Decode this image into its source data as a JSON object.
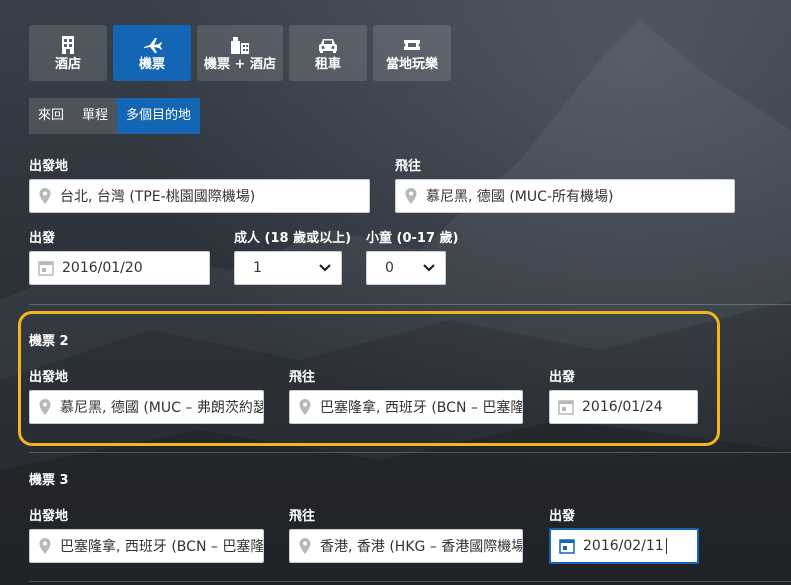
{
  "tabs": [
    {
      "label": "酒店",
      "icon": "hotel-icon"
    },
    {
      "label": "機票",
      "icon": "plane-icon"
    },
    {
      "label": "機票 + 酒店",
      "icon": "plane-hotel-icon"
    },
    {
      "label": "租車",
      "icon": "car-icon"
    },
    {
      "label": "當地玩樂",
      "icon": "ticket-icon"
    }
  ],
  "trip_types": [
    "來回",
    "單程",
    "多個目的地"
  ],
  "leg1": {
    "origin_label": "出發地",
    "origin_value": "台北, 台灣 (TPE-桃園國際機場)",
    "dest_label": "飛往",
    "dest_value": "慕尼黑, 德國 (MUC-所有機場)",
    "depart_label": "出發",
    "depart_value": "2016/01/20",
    "adults_label": "成人 (18 歲或以上)",
    "adults_value": "1",
    "children_label": "小童 (0-17 歲)",
    "children_value": "0"
  },
  "leg2": {
    "title": "機票 2",
    "origin_label": "出發地",
    "origin_value": "慕尼黑, 德國 (MUC – 弗朗茨約瑟夫施特勞斯機場)",
    "dest_label": "飛往",
    "dest_value": "巴塞隆拿, 西班牙 (BCN – 巴塞隆拿埃爾普拉特機場)",
    "depart_label": "出發",
    "depart_value": "2016/01/24"
  },
  "leg3": {
    "title": "機票 3",
    "origin_label": "出發地",
    "origin_value": "巴塞隆拿, 西班牙 (BCN – 巴塞隆拿埃爾普拉特機場)",
    "dest_label": "飛往",
    "dest_value": "香港, 香港 (HKG – 香港國際機場)",
    "depart_label": "出發",
    "depart_value": "2016/02/11"
  },
  "colors": {
    "accent": "#1565b5",
    "highlight": "#f2b51c"
  }
}
